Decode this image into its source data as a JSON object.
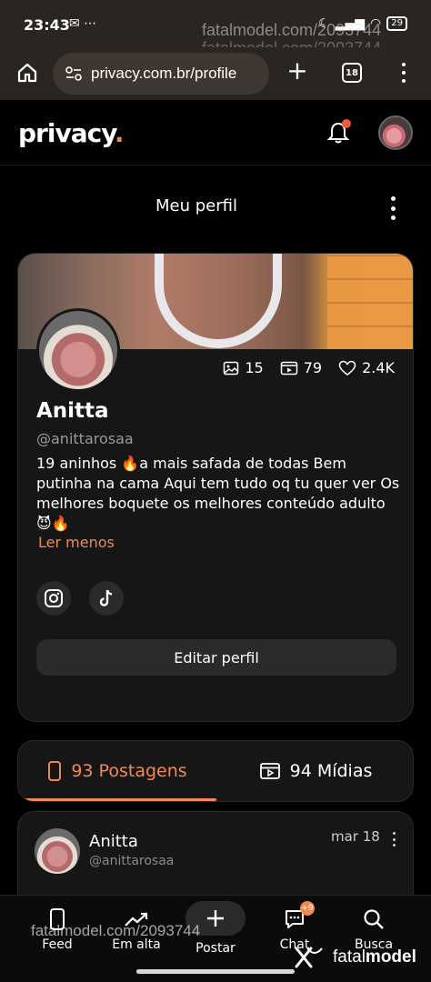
{
  "status_bar": {
    "time": "23:43",
    "left_icons": "✉ ⋯",
    "battery": "29"
  },
  "browser": {
    "url": "privacy.com.br/profile",
    "tabs_count": "18"
  },
  "watermark": {
    "text": "fatalmodel.com/2093744",
    "brand_light": "fatal",
    "brand_bold": "model"
  },
  "app": {
    "logo_text": "privacy",
    "logo_dot": "."
  },
  "page": {
    "title": "Meu perfil"
  },
  "profile": {
    "name": "Anitta",
    "handle": "@anittarosaa",
    "bio": "19 aninhos 🔥a mais safada de todas Bem putinha na cama Aqui tem tudo oq tu quer ver Os melhores boquete os melhores conteúdo adulto 😈🔥",
    "read_less": "Ler menos",
    "stats": {
      "images": "15",
      "videos": "79",
      "likes": "2.4K"
    },
    "edit_button": "Editar perfil"
  },
  "tabs": {
    "posts": "93 Postagens",
    "media": "94 Mídias"
  },
  "post": {
    "name": "Anitta",
    "handle": "@anittarosaa",
    "date": "mar 18"
  },
  "bottom_nav": {
    "feed": "Feed",
    "trending": "Em alta",
    "post": "Postar",
    "chat": "Chat",
    "search": "Busca",
    "chat_badge": "+9"
  },
  "colors": {
    "accent": "#f28a50",
    "background": "#000000",
    "card": "#161616"
  }
}
